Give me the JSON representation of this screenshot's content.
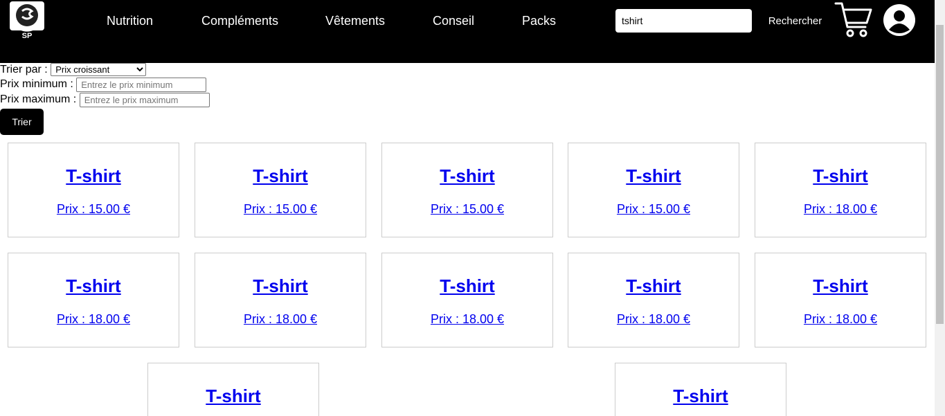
{
  "header": {
    "logo_text": "SP",
    "nav": [
      "Nutrition",
      "Compléments",
      "Vêtements",
      "Conseil",
      "Packs"
    ],
    "search_value": "tshirt",
    "search_button": "Rechercher"
  },
  "filters": {
    "sort_label": "Trier par :",
    "sort_selected": "Prix croissant",
    "min_label": "Prix minimum :",
    "min_placeholder": "Entrez le prix minimum",
    "max_label": "Prix maximum :",
    "max_placeholder": "Entrez le prix maximum",
    "sort_button": "Trier"
  },
  "products": [
    {
      "name": "T-shirt",
      "price": "Prix : 15.00 €"
    },
    {
      "name": "T-shirt",
      "price": "Prix : 15.00 €"
    },
    {
      "name": "T-shirt",
      "price": "Prix : 15.00 €"
    },
    {
      "name": "T-shirt",
      "price": "Prix : 15.00 €"
    },
    {
      "name": "T-shirt",
      "price": "Prix : 18.00 €"
    },
    {
      "name": "T-shirt",
      "price": "Prix : 18.00 €"
    },
    {
      "name": "T-shirt",
      "price": "Prix : 18.00 €"
    },
    {
      "name": "T-shirt",
      "price": "Prix : 18.00 €"
    },
    {
      "name": "T-shirt",
      "price": "Prix : 18.00 €"
    },
    {
      "name": "T-shirt",
      "price": "Prix : 18.00 €"
    },
    {
      "name": "T-shirt",
      "price": ""
    },
    {
      "name": "T-shirt",
      "price": ""
    }
  ]
}
